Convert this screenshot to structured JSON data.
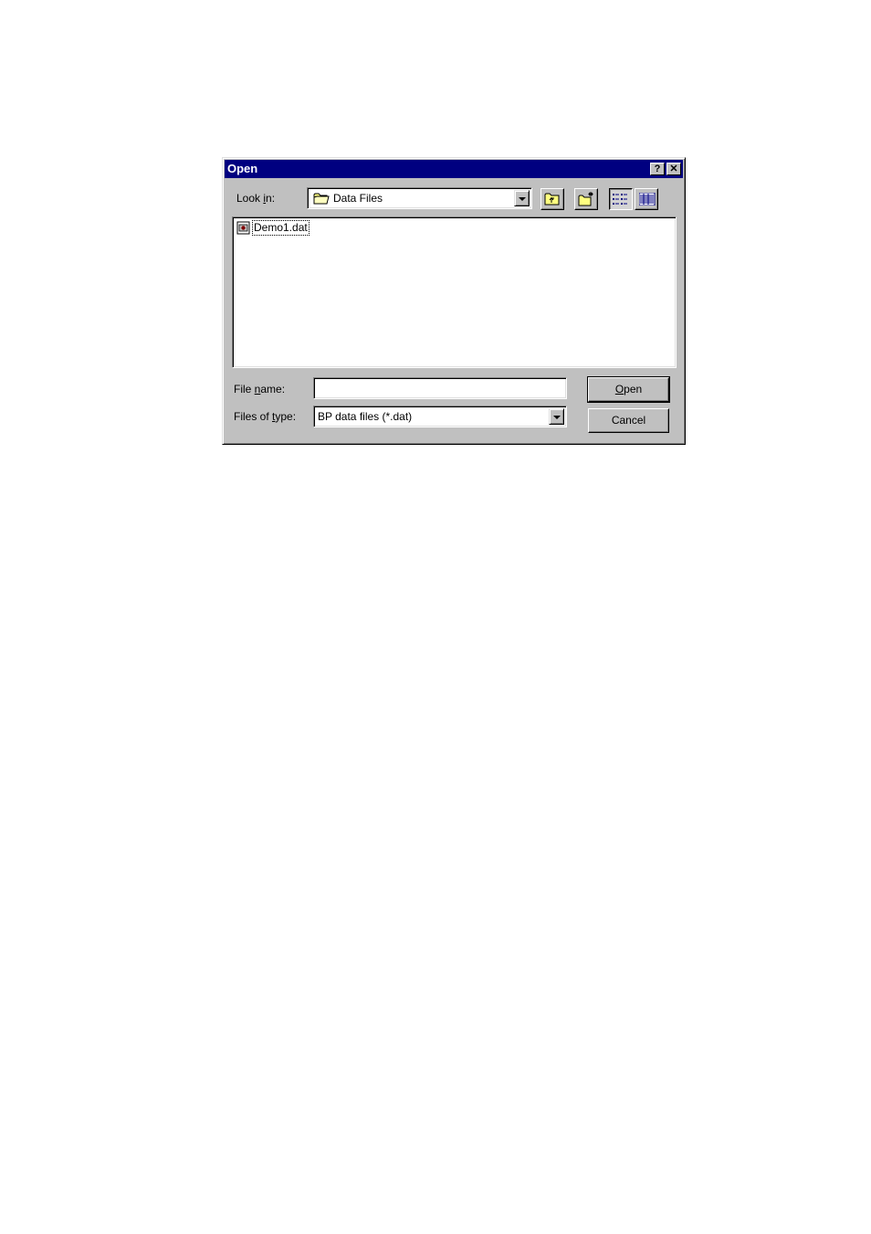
{
  "dialog": {
    "title": "Open",
    "help_button": "?",
    "close_button": "✕"
  },
  "look_in": {
    "label_pre": "Look ",
    "label_accel": "i",
    "label_post": "n:",
    "value": "Data Files"
  },
  "toolbar": {
    "icons": [
      "up-one-level-icon",
      "create-new-folder-icon",
      "list-view-icon",
      "details-view-icon"
    ]
  },
  "files": [
    {
      "name": "Demo1.dat",
      "icon": "data-file-icon"
    }
  ],
  "file_name": {
    "label_pre": "File ",
    "label_accel": "n",
    "label_post": "ame:",
    "value": ""
  },
  "file_type": {
    "label_pre": "Files of ",
    "label_accel": "t",
    "label_post": "ype:",
    "value": "BP data files (*.dat)"
  },
  "buttons": {
    "open_accel": "O",
    "open_rest": "pen",
    "cancel": "Cancel"
  }
}
